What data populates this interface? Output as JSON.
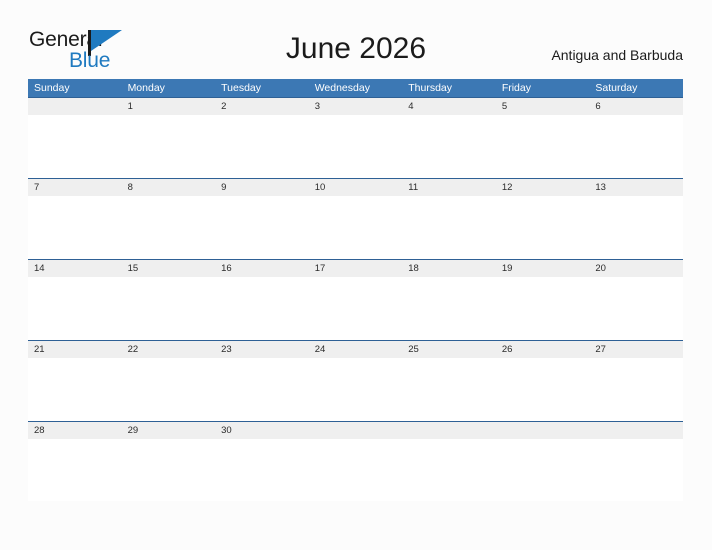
{
  "brand": {
    "name_part1": "General",
    "name_part2": "Blue",
    "mark": "flag-triangle-icon",
    "colors": {
      "blue": "#1f7ac0",
      "dark": "#1b1b1b"
    }
  },
  "header": {
    "title": "June 2026",
    "locale": "Antigua and Barbuda"
  },
  "calendar": {
    "month": "June",
    "year": "2026",
    "colors": {
      "header_blue": "#3c78b4",
      "row_divider_blue": "#2e6095",
      "date_band_gray": "#efefef",
      "cell_white": "#ffffff",
      "page_background": "#fcfcfc"
    },
    "weekdays": [
      {
        "label": "Sunday"
      },
      {
        "label": "Monday"
      },
      {
        "label": "Tuesday"
      },
      {
        "label": "Wednesday"
      },
      {
        "label": "Thursday"
      },
      {
        "label": "Friday"
      },
      {
        "label": "Saturday"
      }
    ],
    "weeks": [
      {
        "days": [
          {
            "date": ""
          },
          {
            "date": "1"
          },
          {
            "date": "2"
          },
          {
            "date": "3"
          },
          {
            "date": "4"
          },
          {
            "date": "5"
          },
          {
            "date": "6"
          }
        ]
      },
      {
        "days": [
          {
            "date": "7"
          },
          {
            "date": "8"
          },
          {
            "date": "9"
          },
          {
            "date": "10"
          },
          {
            "date": "11"
          },
          {
            "date": "12"
          },
          {
            "date": "13"
          }
        ]
      },
      {
        "days": [
          {
            "date": "14"
          },
          {
            "date": "15"
          },
          {
            "date": "16"
          },
          {
            "date": "17"
          },
          {
            "date": "18"
          },
          {
            "date": "19"
          },
          {
            "date": "20"
          }
        ]
      },
      {
        "days": [
          {
            "date": "21"
          },
          {
            "date": "22"
          },
          {
            "date": "23"
          },
          {
            "date": "24"
          },
          {
            "date": "25"
          },
          {
            "date": "26"
          },
          {
            "date": "27"
          }
        ]
      },
      {
        "days": [
          {
            "date": "28"
          },
          {
            "date": "29"
          },
          {
            "date": "30"
          },
          {
            "date": ""
          },
          {
            "date": ""
          },
          {
            "date": ""
          },
          {
            "date": ""
          }
        ]
      }
    ]
  }
}
